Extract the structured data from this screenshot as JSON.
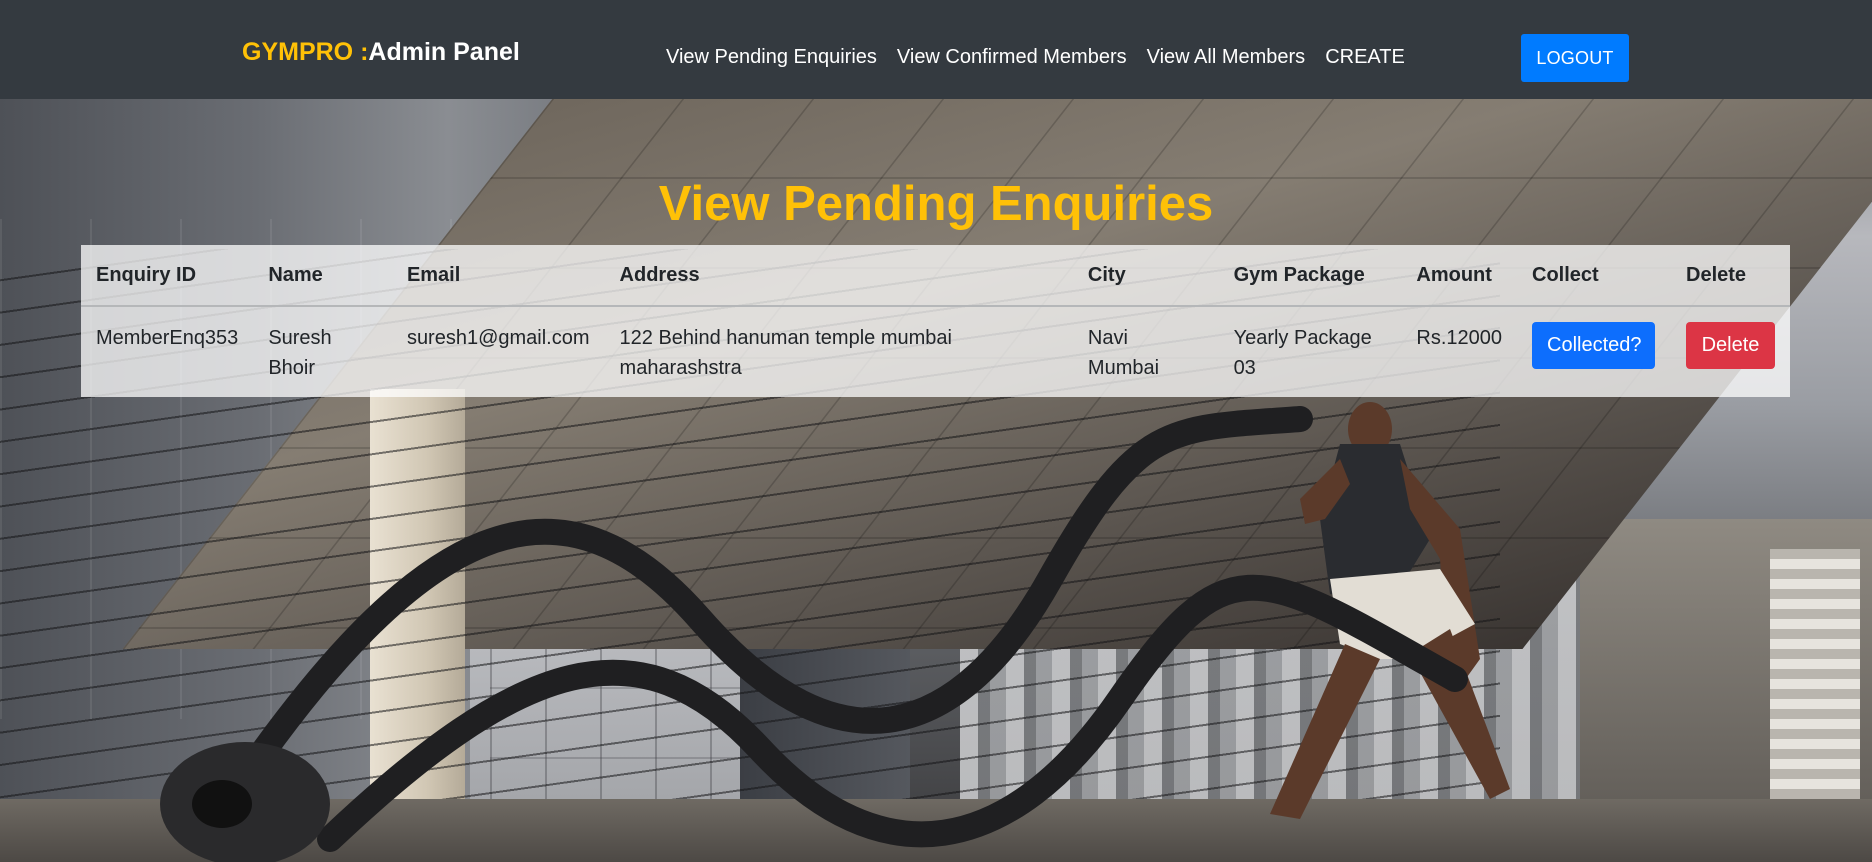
{
  "navbar": {
    "brand_accent": "GYMPRO :",
    "brand_rest": "Admin Panel",
    "links": [
      "View Pending Enquiries",
      "View Confirmed Members",
      "View All Members",
      "CREATE"
    ],
    "logout_label": "LOGOUT"
  },
  "main": {
    "title": "View Pending Enquiries",
    "table": {
      "headers": [
        "Enquiry ID",
        "Name",
        "Email",
        "Address",
        "City",
        "Gym Package",
        "Amount",
        "Collect",
        "Delete"
      ],
      "rows": [
        {
          "enquiry_id": "MemberEnq353",
          "name": "Suresh Bhoir",
          "email": "suresh1@gmail.com",
          "address": "122 Behind hanuman temple mumbai maharashstra",
          "city": "Navi Mumbai",
          "package": "Yearly Package 03",
          "amount": "Rs.12000",
          "collect_label": "Collected?",
          "delete_label": "Delete"
        }
      ]
    }
  },
  "colors": {
    "accent": "#ffc107",
    "navbar_bg": "#343a40",
    "primary": "#0d6efd",
    "danger": "#dc3545"
  }
}
